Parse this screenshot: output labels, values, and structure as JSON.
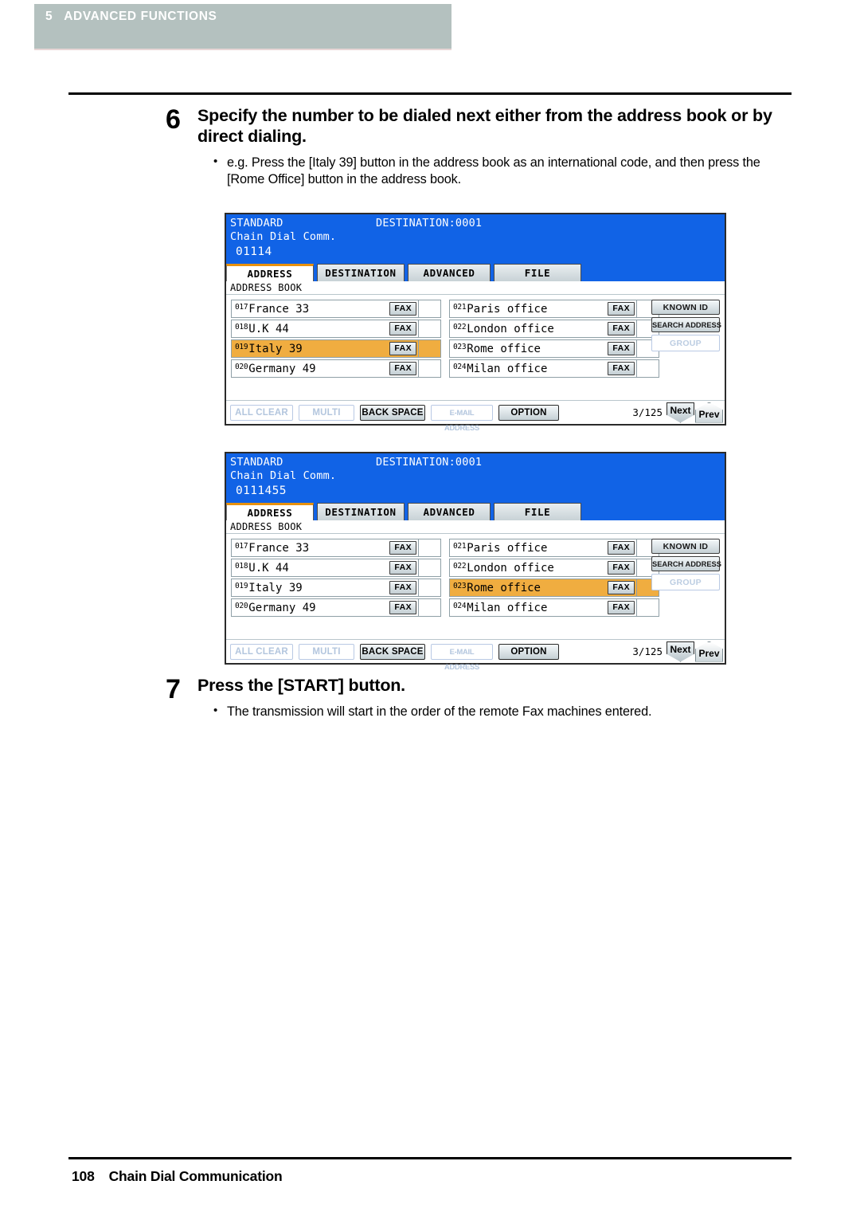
{
  "chapter": {
    "number": "5",
    "title": "ADVANCED FUNCTIONS",
    "bar_color": "#b4c1bf"
  },
  "steps": [
    {
      "number": "6",
      "title": "Specify the number to be dialed next either from the address book or by direct dialing.",
      "bullets": [
        "e.g. Press the [Italy 39] button in the address book as an international code, and then press the [Rome Office] button in the address book."
      ]
    },
    {
      "number": "7",
      "title": "Press the [START] button.",
      "bullets": [
        "The transmission will start in the order of the remote Fax machines entered."
      ]
    }
  ],
  "panels": [
    {
      "header": {
        "mode": "STANDARD",
        "destination": "DESTINATION:0001",
        "subtitle": "Chain Dial Comm.",
        "number": "01114",
        "background": "#1163e6"
      },
      "tabs": [
        {
          "label": "ADDRESS",
          "active": true
        },
        {
          "label": "DESTINATION",
          "active": false
        },
        {
          "label": "ADVANCED",
          "active": false
        },
        {
          "label": "FILE",
          "active": false
        }
      ],
      "address_book_label": "ADDRESS BOOK",
      "entries_left": [
        {
          "id": "017",
          "name": "France 33",
          "fax": "FAX",
          "selected": false
        },
        {
          "id": "018",
          "name": "U.K 44",
          "fax": "FAX",
          "selected": false
        },
        {
          "id": "019",
          "name": "Italy 39",
          "fax": "FAX",
          "selected": true
        },
        {
          "id": "020",
          "name": "Germany 49",
          "fax": "FAX",
          "selected": false
        }
      ],
      "entries_right": [
        {
          "id": "021",
          "name": "Paris office",
          "fax": "FAX",
          "selected": false
        },
        {
          "id": "022",
          "name": "London office",
          "fax": "FAX",
          "selected": false
        },
        {
          "id": "023",
          "name": "Rome office",
          "fax": "FAX",
          "selected": false
        },
        {
          "id": "024",
          "name": "Milan office",
          "fax": "FAX",
          "selected": false
        }
      ],
      "side_buttons": [
        {
          "label": "KNOWN ID",
          "disabled": false
        },
        {
          "label": "SEARCH ADDRESS",
          "disabled": false
        },
        {
          "label": "GROUP",
          "disabled": true
        }
      ],
      "toolbar": {
        "all_clear": "ALL CLEAR",
        "multi": "MULTI",
        "back_space": "BACK SPACE",
        "email_address": "E-MAIL ADDRESS",
        "option": "OPTION",
        "page_count": "3/125",
        "next": "Next",
        "prev": "Prev"
      },
      "selection_color": "#f0ad40"
    },
    {
      "header": {
        "mode": "STANDARD",
        "destination": "DESTINATION:0001",
        "subtitle": "Chain Dial Comm.",
        "number": "0111455",
        "background": "#1163e6"
      },
      "tabs": [
        {
          "label": "ADDRESS",
          "active": true
        },
        {
          "label": "DESTINATION",
          "active": false
        },
        {
          "label": "ADVANCED",
          "active": false
        },
        {
          "label": "FILE",
          "active": false
        }
      ],
      "address_book_label": "ADDRESS BOOK",
      "entries_left": [
        {
          "id": "017",
          "name": "France 33",
          "fax": "FAX",
          "selected": false
        },
        {
          "id": "018",
          "name": "U.K 44",
          "fax": "FAX",
          "selected": false
        },
        {
          "id": "019",
          "name": "Italy 39",
          "fax": "FAX",
          "selected": false
        },
        {
          "id": "020",
          "name": "Germany 49",
          "fax": "FAX",
          "selected": false
        }
      ],
      "entries_right": [
        {
          "id": "021",
          "name": "Paris office",
          "fax": "FAX",
          "selected": false
        },
        {
          "id": "022",
          "name": "London office",
          "fax": "FAX",
          "selected": false
        },
        {
          "id": "023",
          "name": "Rome office",
          "fax": "FAX",
          "selected": true
        },
        {
          "id": "024",
          "name": "Milan office",
          "fax": "FAX",
          "selected": false
        }
      ],
      "side_buttons": [
        {
          "label": "KNOWN ID",
          "disabled": false
        },
        {
          "label": "SEARCH ADDRESS",
          "disabled": false
        },
        {
          "label": "GROUP",
          "disabled": true
        }
      ],
      "toolbar": {
        "all_clear": "ALL CLEAR",
        "multi": "MULTI",
        "back_space": "BACK SPACE",
        "email_address": "E-MAIL ADDRESS",
        "option": "OPTION",
        "page_count": "3/125",
        "next": "Next",
        "prev": "Prev"
      },
      "selection_color": "#f0ad40"
    }
  ],
  "footer": {
    "page_number": "108",
    "section_title": "Chain Dial Communication"
  }
}
